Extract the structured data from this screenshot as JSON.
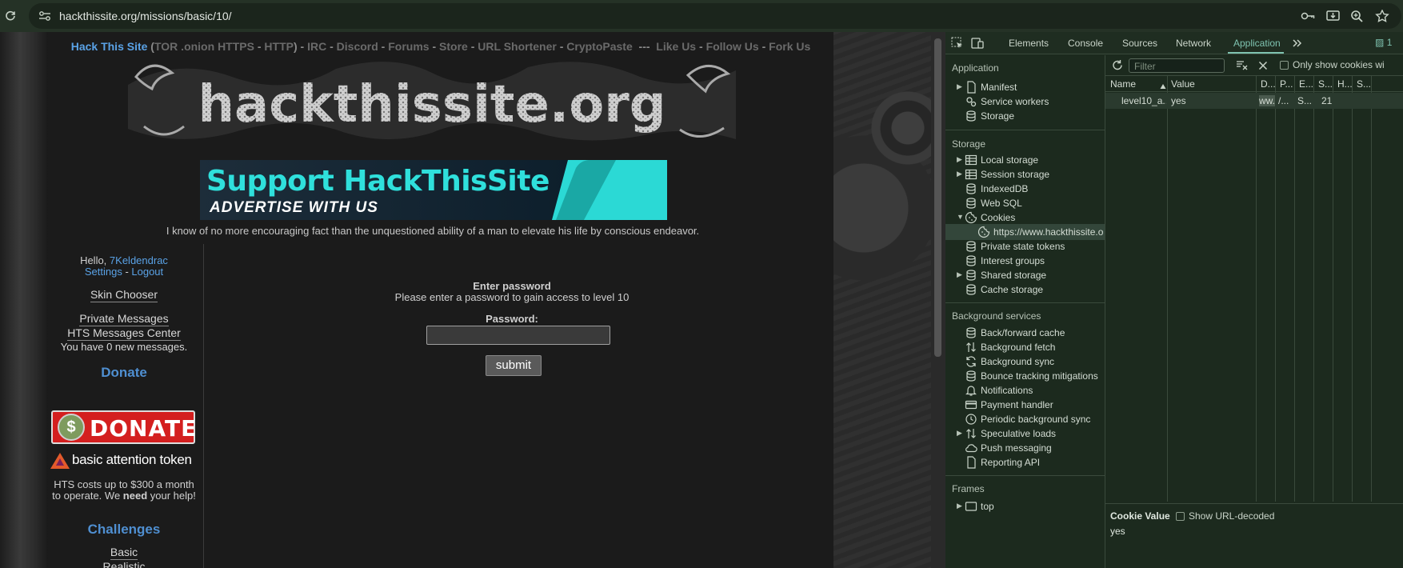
{
  "browser": {
    "url": "hackthissite.org/missions/basic/10/",
    "icons": [
      "reload-icon",
      "site-info-icon",
      "password-key-icon",
      "install-app-icon",
      "zoom-icon",
      "bookmark-star-icon"
    ]
  },
  "site": {
    "nav": {
      "home": "Hack This Site",
      "paren_open": " (",
      "tor": "TOR .onion",
      "https": "HTTPS",
      "dash1": " - ",
      "http": "HTTP",
      "paren_close": ") - ",
      "irc": "IRC",
      "discord": "Discord",
      "forums": "Forums",
      "store": "Store",
      "url_shortener": "URL Shortener",
      "cryptopaste": "CryptoPaste",
      "sep": "  ---  ",
      "like": "Like Us",
      "follow": "Follow Us",
      "fork": "Fork Us",
      "dash": " - "
    },
    "logo_text": "hackthissite.org",
    "banner": {
      "line1": "Support HackThisSite",
      "line2": "ADVERTISE WITH US"
    },
    "quote": "I know of no more encouraging fact than the unquestioned ability of a man to elevate his life by conscious endeavor.",
    "sidebar": {
      "hello": "Hello, ",
      "username": "7Keldendrac",
      "settings": "Settings",
      "logout": "Logout",
      "dash": " - ",
      "skin_chooser": "Skin Chooser",
      "private_messages": "Private Messages",
      "hts_messages": "HTS Messages Center",
      "new_messages": "You have 0 new messages.",
      "donate_heading": "Donate",
      "donate_button": "DONATE",
      "donate_coin": "$",
      "bat": "basic attention token",
      "cost_pre": "HTS costs up to $300 a month to operate. We ",
      "cost_need": "need",
      "cost_post": " your help!",
      "challenges_heading": "Challenges",
      "basic": "Basic",
      "realistic": "Realistic"
    },
    "form": {
      "heading": "Enter password",
      "subtitle": "Please enter a password to gain access to level 10",
      "password_label": "Password:",
      "password_value": "",
      "submit": "submit"
    }
  },
  "devtools": {
    "tabs": [
      "Elements",
      "Console",
      "Sources",
      "Network",
      "Application"
    ],
    "active_tab": "Application",
    "issues_count": "1",
    "sidebar": {
      "application_heading": "Application",
      "application_items": [
        "Manifest",
        "Service workers",
        "Storage"
      ],
      "storage_heading": "Storage",
      "storage_items": [
        "Local storage",
        "Session storage",
        "IndexedDB",
        "Web SQL",
        "Cookies",
        "https://www.hackthissite.o",
        "Private state tokens",
        "Interest groups",
        "Shared storage",
        "Cache storage"
      ],
      "background_heading": "Background services",
      "background_items": [
        "Back/forward cache",
        "Background fetch",
        "Background sync",
        "Bounce tracking mitigations",
        "Notifications",
        "Payment handler",
        "Periodic background sync",
        "Speculative loads",
        "Push messaging",
        "Reporting API"
      ],
      "frames_heading": "Frames",
      "frames_items": [
        "top"
      ]
    },
    "toolbar": {
      "filter_placeholder": "Filter",
      "only_show": "Only show cookies wi"
    },
    "table": {
      "columns": [
        "Name",
        "Value",
        "D...",
        "P...",
        "E...",
        "S...",
        "H...",
        "S..."
      ],
      "rows": [
        {
          "name": "level10_a...",
          "value": "yes",
          "domain": "ww...",
          "path": "/...",
          "expires": "S...",
          "size": "21"
        }
      ]
    },
    "cookie_value": {
      "heading": "Cookie Value",
      "show_decoded": "Show URL-decoded",
      "value": "yes"
    }
  }
}
